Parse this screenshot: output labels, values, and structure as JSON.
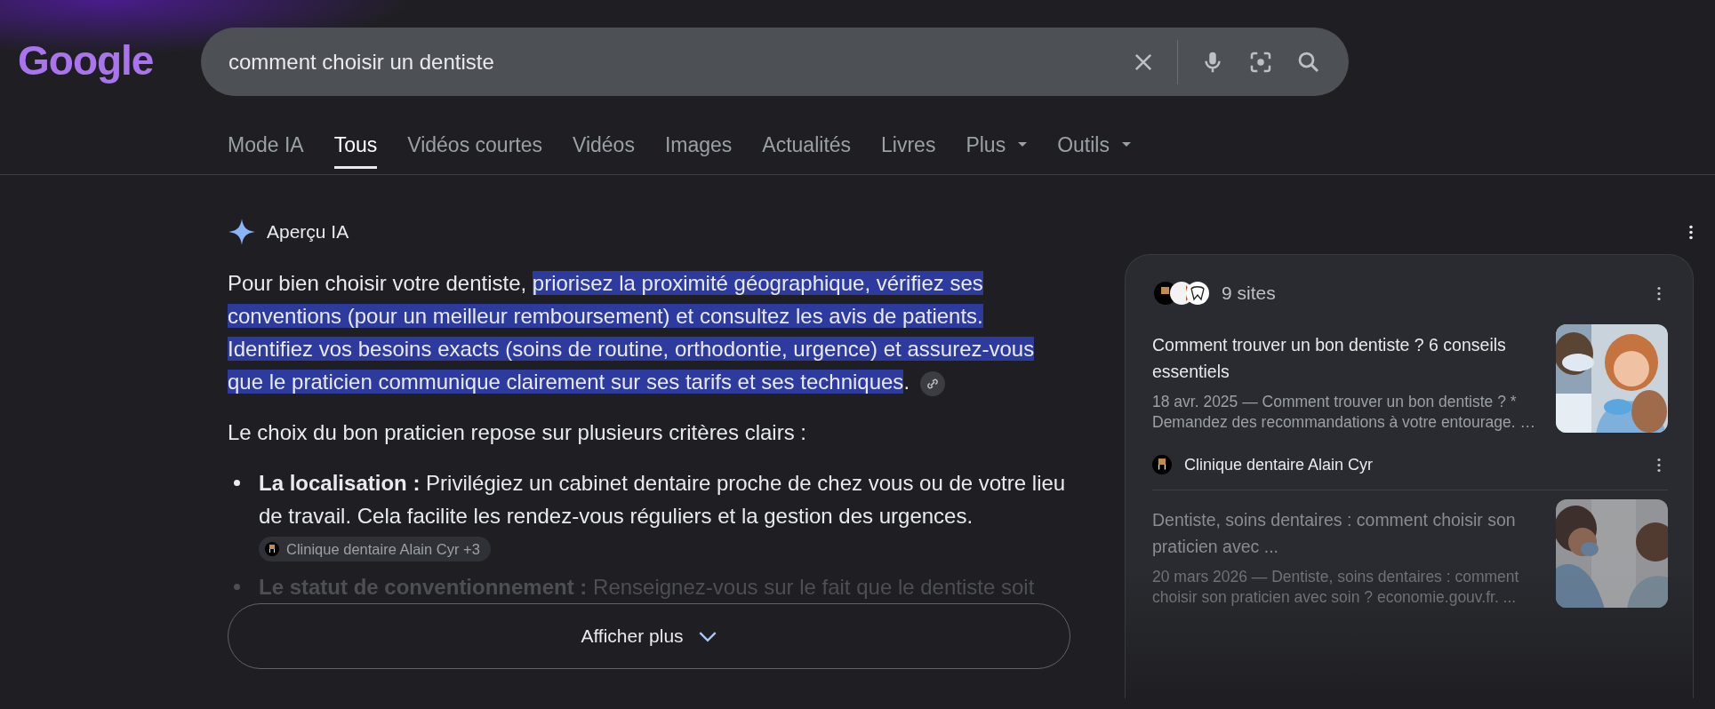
{
  "logo": {
    "text": "Google"
  },
  "search": {
    "value": "comment choisir un dentiste"
  },
  "tabs": [
    {
      "label": "Mode IA",
      "selected": false,
      "kind": "link"
    },
    {
      "label": "Tous",
      "selected": true,
      "kind": "link"
    },
    {
      "label": "Vidéos courtes",
      "selected": false,
      "kind": "link"
    },
    {
      "label": "Vidéos",
      "selected": false,
      "kind": "link"
    },
    {
      "label": "Images",
      "selected": false,
      "kind": "link"
    },
    {
      "label": "Actualités",
      "selected": false,
      "kind": "link"
    },
    {
      "label": "Livres",
      "selected": false,
      "kind": "link"
    },
    {
      "label": "Plus",
      "selected": false,
      "kind": "menu"
    },
    {
      "label": "Outils",
      "selected": false,
      "kind": "menu"
    }
  ],
  "overview": {
    "title": "Aperçu IA",
    "intro": {
      "lead": "Pour bien choisir votre dentiste, ",
      "highlight": "priorisez la proximité géographique, vérifiez ses conventions (pour un meilleur remboursement) et consultez les avis de patients. Identifiez vos besoins exacts (soins de routine, orthodontie, urgence) et assurez-vous que le praticien communique clairement sur ses tarifs et ses techniques",
      "tail": "."
    },
    "lead_in": "Le choix du bon praticien repose sur plusieurs critères clairs :",
    "bullets": [
      {
        "text": "**La localisation :** Privilégiez un cabinet dentaire proche de chez vous ou de votre lieu de travail. Cela facilite les rendez-vous réguliers et la gestion des urgences.",
        "source": "Clinique dentaire Alain Cyr +3",
        "faded": false
      },
      {
        "text": "**Le statut de conventionnement :** Renseignez-vous sur le fait que le dentiste soit",
        "faded": true
      }
    ],
    "more_button": "Afficher plus"
  },
  "sources": {
    "count": "9 sites",
    "results": [
      {
        "title": "Comment trouver un bon dentiste ? 6 conseils essentiels",
        "snippet": "18 avr. 2025 — Comment trouver un bon dentiste ? * Demandez des recommandations à votre entourage. …",
        "site": "Clinique dentaire Alain Cyr",
        "faded": false
      },
      {
        "title": "Dentiste, soins dentaires : comment choisir son praticien avec ...",
        "snippet": "20 mars 2026 — Dentiste, soins dentaires : comment choisir son praticien avec soin ? economie.gouv.fr. ...",
        "faded": true
      }
    ]
  }
}
